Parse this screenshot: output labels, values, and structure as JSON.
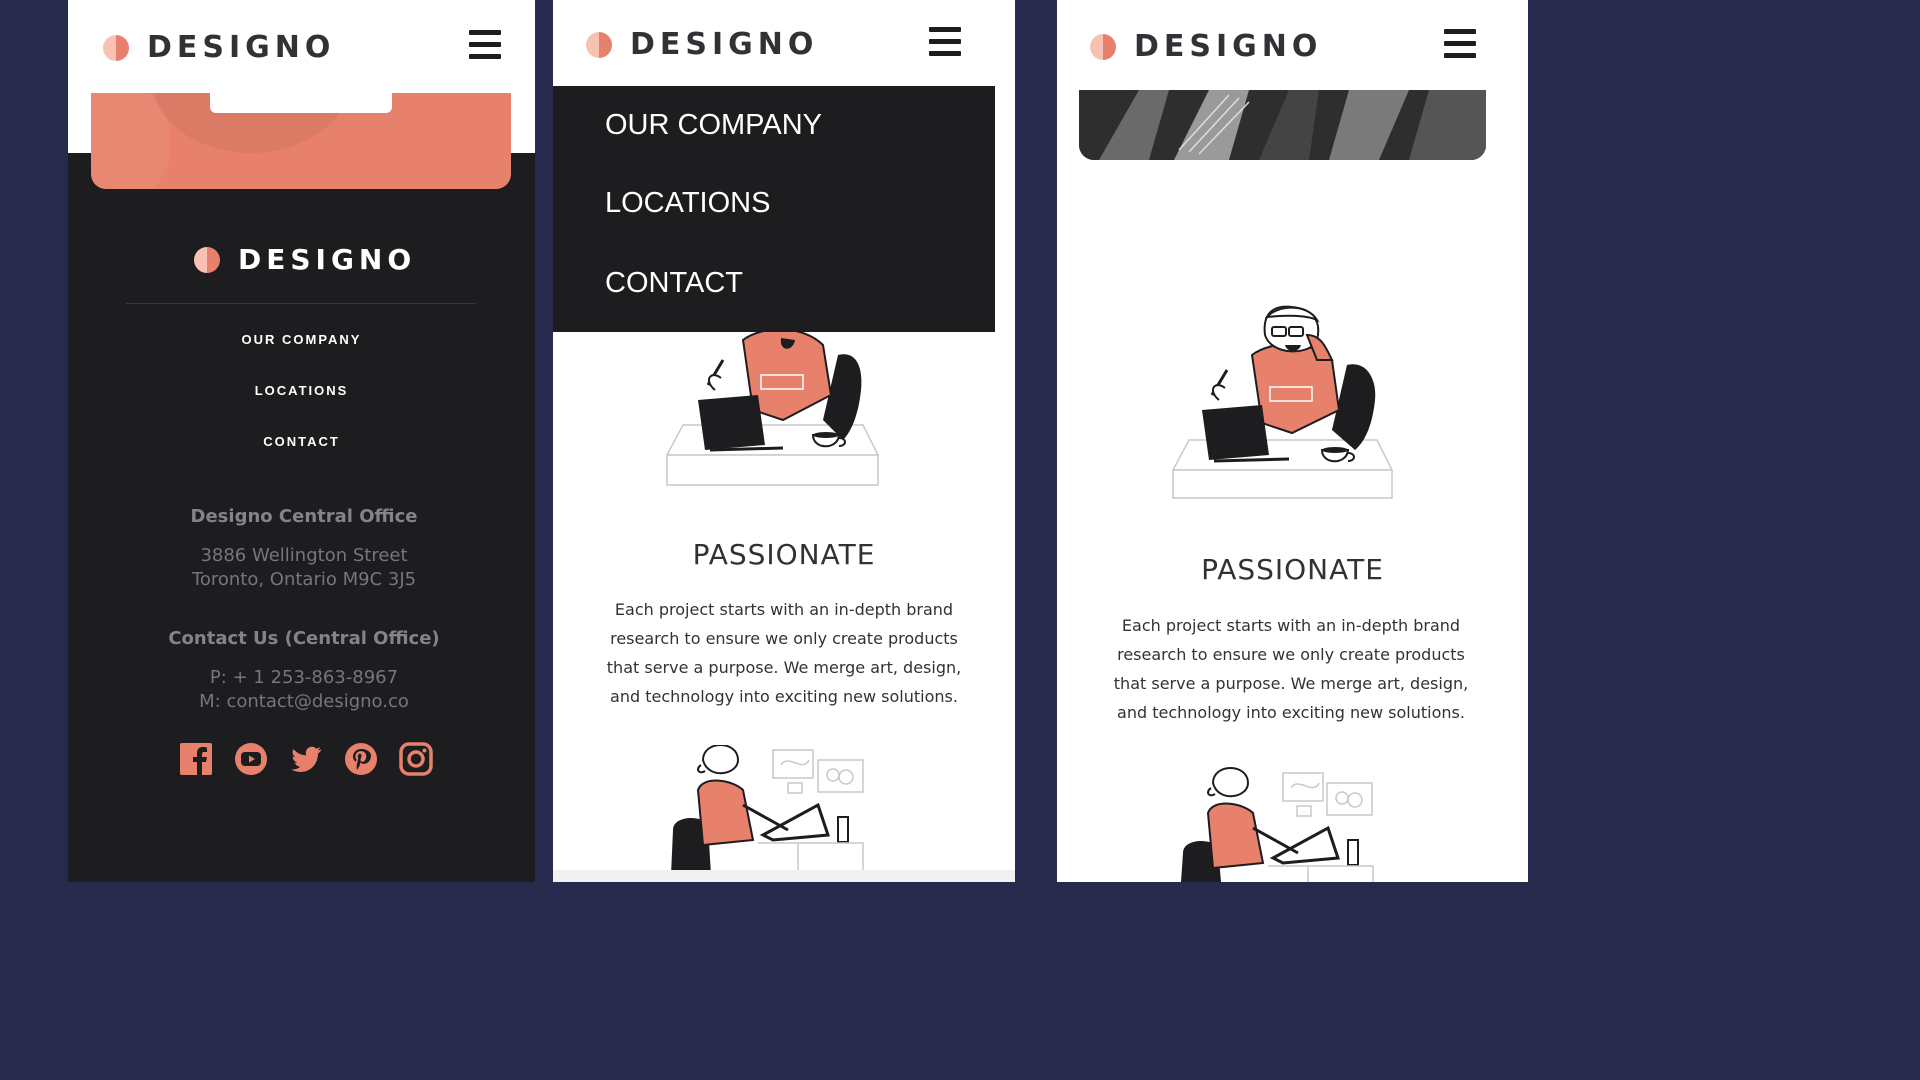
{
  "brand": {
    "name": "DESIGNO"
  },
  "nav": {
    "items": [
      {
        "label": "OUR COMPANY"
      },
      {
        "label": "LOCATIONS"
      },
      {
        "label": "CONTACT"
      }
    ]
  },
  "footer": {
    "office_title": "Designo Central Office",
    "address_line1": "3886 Wellington Street",
    "address_line2": "Toronto, Ontario M9C 3J5",
    "contact_title": "Contact Us (Central Office)",
    "phone": "P: + 1 253-863-8967",
    "email": "M: contact@designo.co",
    "social": [
      {
        "name": "facebook-icon"
      },
      {
        "name": "youtube-icon"
      },
      {
        "name": "twitter-icon"
      },
      {
        "name": "pinterest-icon"
      },
      {
        "name": "instagram-icon"
      }
    ]
  },
  "feature": {
    "title": "PASSIONATE",
    "text": "Each project starts with an in-depth brand research to ensure we only create products that serve a purpose. We merge art, design, and technology into exciting new solutions."
  },
  "colors": {
    "accent": "#e7816b",
    "dark": "#1d1c1f",
    "backdrop": "#272a4c"
  }
}
